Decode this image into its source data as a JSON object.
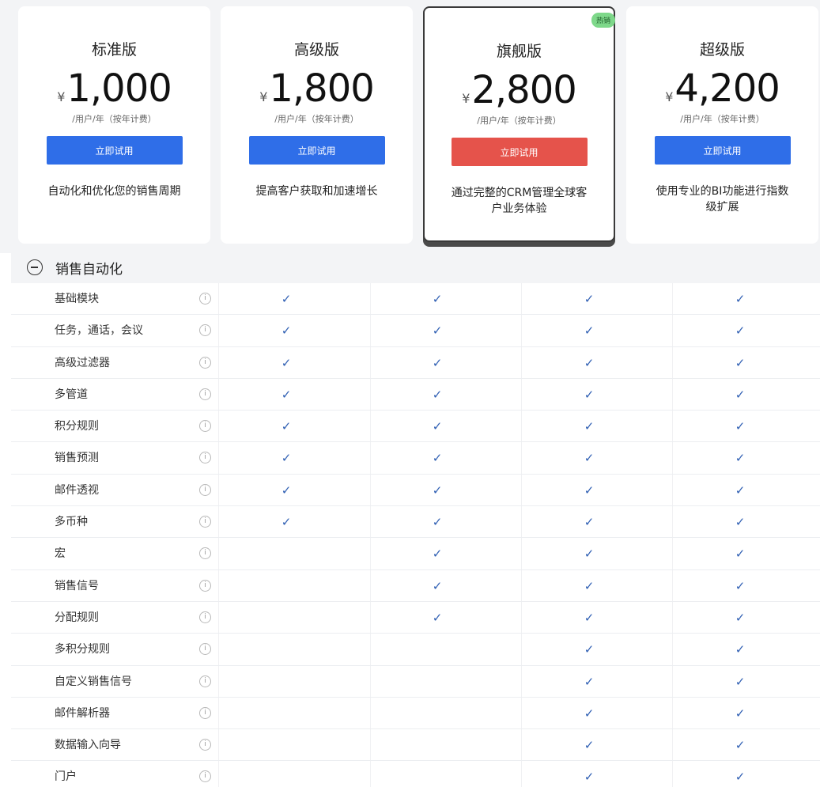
{
  "plans": [
    {
      "name": "标准版",
      "currency": "¥",
      "price": "1,000",
      "unit": "/用户/年（按年计费）",
      "cta": "立即试用",
      "desc": "自动化和优化您的销售周期"
    },
    {
      "name": "高级版",
      "currency": "¥",
      "price": "1,800",
      "unit": "/用户/年（按年计费）",
      "cta": "立即试用",
      "desc": "提高客户获取和加速增长"
    },
    {
      "name": "旗舰版",
      "currency": "¥",
      "price": "2,800",
      "unit": "/用户/年（按年计费）",
      "cta": "立即试用",
      "desc": "通过完整的CRM管理全球客户业务体验",
      "badge": "热销"
    },
    {
      "name": "超级版",
      "currency": "¥",
      "price": "4,200",
      "unit": "/用户/年（按年计费）",
      "cta": "立即试用",
      "desc": "使用专业的BI功能进行指数级扩展"
    }
  ],
  "section": {
    "title": "销售自动化",
    "icon": "minus-circle-icon"
  },
  "features": [
    {
      "name": "基础模块",
      "checks": [
        true,
        true,
        true,
        true
      ]
    },
    {
      "name": "任务，通话，会议",
      "checks": [
        true,
        true,
        true,
        true
      ]
    },
    {
      "name": "高级过滤器",
      "checks": [
        true,
        true,
        true,
        true
      ]
    },
    {
      "name": "多管道",
      "checks": [
        true,
        true,
        true,
        true
      ]
    },
    {
      "name": "积分规则",
      "checks": [
        true,
        true,
        true,
        true
      ]
    },
    {
      "name": "销售预测",
      "checks": [
        true,
        true,
        true,
        true
      ]
    },
    {
      "name": "邮件透视",
      "checks": [
        true,
        true,
        true,
        true
      ]
    },
    {
      "name": "多币种",
      "checks": [
        true,
        true,
        true,
        true
      ]
    },
    {
      "name": "宏",
      "checks": [
        false,
        true,
        true,
        true
      ]
    },
    {
      "name": "销售信号",
      "checks": [
        false,
        true,
        true,
        true
      ]
    },
    {
      "name": "分配规则",
      "checks": [
        false,
        true,
        true,
        true
      ]
    },
    {
      "name": "多积分规则",
      "checks": [
        false,
        false,
        true,
        true
      ]
    },
    {
      "name": "自定义销售信号",
      "checks": [
        false,
        false,
        true,
        true
      ]
    },
    {
      "name": "邮件解析器",
      "checks": [
        false,
        false,
        true,
        true
      ]
    },
    {
      "name": "数据输入向导",
      "checks": [
        false,
        false,
        true,
        true
      ]
    },
    {
      "name": "门户",
      "checks": [
        false,
        false,
        true,
        true
      ]
    }
  ],
  "check_glyph": "✓",
  "info_glyph": "i",
  "colors": {
    "primary_button": "#2f6ee8",
    "featured_button": "#e5534b",
    "check": "#2f5fb3",
    "badge": "#7ed88a"
  }
}
